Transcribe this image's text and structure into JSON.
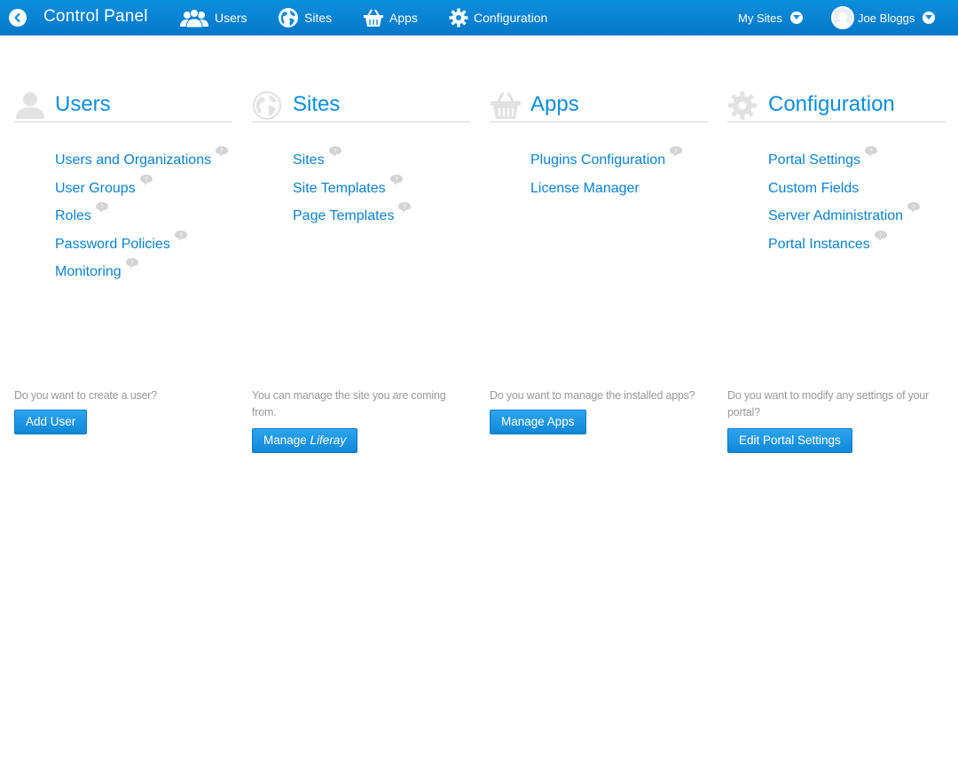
{
  "topbar": {
    "title": "Control Panel",
    "nav": {
      "users": "Users",
      "sites": "Sites",
      "apps": "Apps",
      "configuration": "Configuration"
    },
    "my_sites": "My Sites",
    "user_name": "Joe Bloggs",
    "bar_color": "#0a8fdd"
  },
  "sections": [
    {
      "title": "Users",
      "icon": "users-icon",
      "links": [
        "Users and Organizations",
        "User Groups",
        "Roles",
        "Password Policies",
        "Monitoring"
      ],
      "prompt": "Do you want to create a user?",
      "button": "Add User"
    },
    {
      "title": "Sites",
      "icon": "globe-icon",
      "links": [
        "Sites",
        "Site Templates",
        "Page Templates"
      ],
      "prompt": "You can manage the site you are coming from.",
      "button_prefix": "Manage ",
      "button_emph": "Liferay"
    },
    {
      "title": "Apps",
      "icon": "basket-icon",
      "links": [
        "Plugins Configuration",
        "License Manager"
      ],
      "prompt": "Do you want to manage the installed apps?",
      "button": "Manage Apps"
    },
    {
      "title": "Configuration",
      "icon": "gear-icon",
      "links": [
        "Portal Settings",
        "Custom Fields",
        "Server Administration",
        "Portal Instances"
      ],
      "prompt": "Do you want to modify any settings of your portal?",
      "button": "Edit Portal Settings"
    }
  ],
  "link_color": "#0a82cf"
}
